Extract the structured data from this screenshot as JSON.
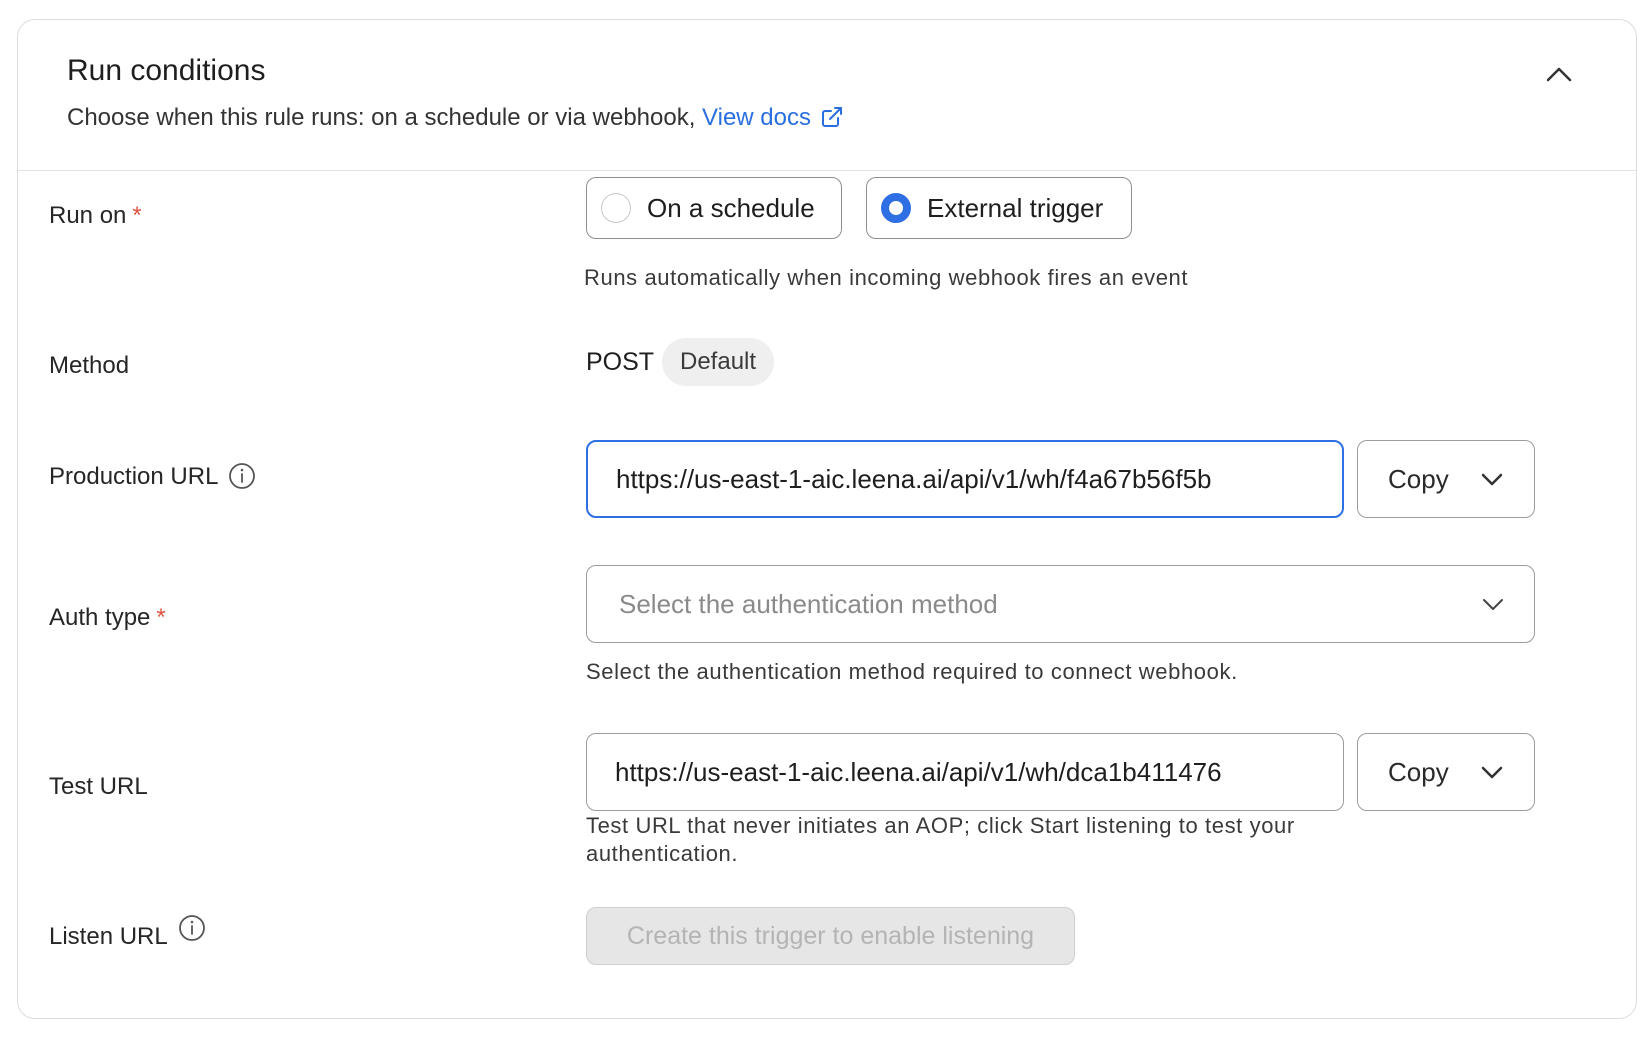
{
  "header": {
    "title": "Run conditions",
    "subtitle": "Choose when this rule runs: on a schedule or via webhook,",
    "docs_link": "View docs"
  },
  "run_on": {
    "label": "Run on",
    "required_mark": "*",
    "options": [
      {
        "label": "On a schedule",
        "selected": false
      },
      {
        "label": "External trigger",
        "selected": true
      }
    ],
    "help": "Runs automatically when incoming webhook fires an event"
  },
  "method": {
    "label": "Method",
    "value": "POST",
    "badge": "Default"
  },
  "production_url": {
    "label": "Production URL",
    "value": "https://us-east-1-aic.leena.ai/api/v1/wh/f4a67b56f5b",
    "copy_label": "Copy"
  },
  "auth_type": {
    "label": "Auth type",
    "required_mark": "*",
    "placeholder": "Select the authentication method",
    "help": "Select the authentication method required to connect webhook."
  },
  "test_url": {
    "label": "Test URL",
    "value": "https://us-east-1-aic.leena.ai/api/v1/wh/dca1b411476",
    "copy_label": "Copy",
    "help_line1": "Test URL that never initiates an AOP; click Start listening to test your",
    "help_line2": "authentication."
  },
  "listen_url": {
    "label": "Listen URL",
    "button_label": "Create this trigger to enable listening"
  },
  "colors": {
    "accent": "#2f6fe4",
    "link": "#2b6fdf",
    "required": "#e0523f"
  }
}
